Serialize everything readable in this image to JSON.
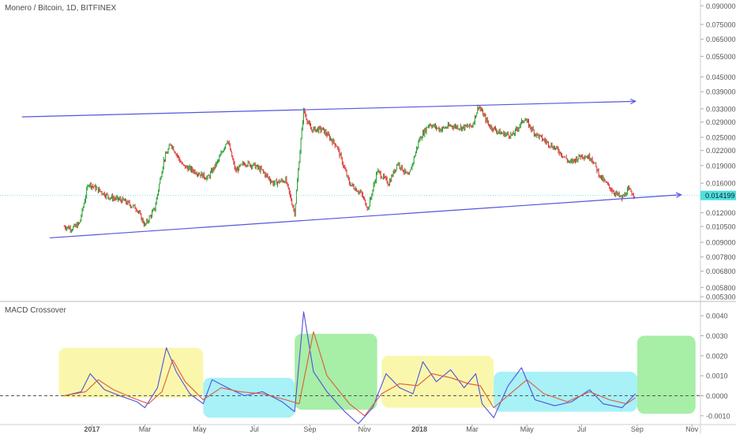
{
  "header": {
    "symbol_title": "Monero / Bitcoin, 1D, BITFINEX",
    "macd_title": "MACD Crossover"
  },
  "price_badge": "0.014199",
  "colors": {
    "up_candle": "#1f9d2a",
    "down_candle": "#e03030",
    "trendline": "#5555dd",
    "badge": "#4ee0e0",
    "macd_line": "#5050dd",
    "signal_line": "#e05a3a",
    "zero_line": "#555555",
    "yellow_box": "#f5f06a",
    "cyan_box": "#5ee6f0",
    "green_box": "#5fe05f"
  },
  "chart_data": [
    {
      "type": "candlestick",
      "title": "Monero / Bitcoin, 1D, BITFINEX",
      "y_scale": "log",
      "ylim": [
        0.0051,
        0.095
      ],
      "y_ticks": [
        "0.090000",
        "0.075000",
        "0.065000",
        "0.055000",
        "0.045000",
        "0.039000",
        "0.033000",
        "0.029000",
        "0.025000",
        "0.022000",
        "0.019000",
        "0.016000",
        "0.014199",
        "0.012000",
        "0.010500",
        "0.009000",
        "0.007800",
        "0.006800",
        "0.005800",
        "0.005300"
      ],
      "x_ticks": [
        "2017",
        "Mar",
        "May",
        "Jul",
        "Sep",
        "Nov",
        "2018",
        "Mar",
        "May",
        "Jul",
        "Sep",
        "Nov"
      ],
      "x_range": [
        "2016-10-01",
        "2018-11-30"
      ],
      "price_path": [
        [
          "2016-12-01",
          0.0105
        ],
        [
          "2016-12-10",
          0.0103
        ],
        [
          "2016-12-18",
          0.0108
        ],
        [
          "2016-12-28",
          0.016
        ],
        [
          "2017-01-08",
          0.015
        ],
        [
          "2017-01-20",
          0.014
        ],
        [
          "2017-02-05",
          0.0135
        ],
        [
          "2017-02-20",
          0.0125
        ],
        [
          "2017-03-01",
          0.0106
        ],
        [
          "2017-03-12",
          0.0125
        ],
        [
          "2017-03-22",
          0.02
        ],
        [
          "2017-03-30",
          0.0235
        ],
        [
          "2017-04-12",
          0.019
        ],
        [
          "2017-04-28",
          0.0178
        ],
        [
          "2017-05-10",
          0.0168
        ],
        [
          "2017-05-22",
          0.02
        ],
        [
          "2017-06-01",
          0.0245
        ],
        [
          "2017-06-10",
          0.018
        ],
        [
          "2017-06-20",
          0.0195
        ],
        [
          "2017-07-01",
          0.019
        ],
        [
          "2017-07-10",
          0.018
        ],
        [
          "2017-07-22",
          0.016
        ],
        [
          "2017-08-05",
          0.0165
        ],
        [
          "2017-08-15",
          0.012
        ],
        [
          "2017-08-20",
          0.02
        ],
        [
          "2017-08-25",
          0.0325
        ],
        [
          "2017-09-02",
          0.027
        ],
        [
          "2017-09-15",
          0.027
        ],
        [
          "2017-10-01",
          0.023
        ],
        [
          "2017-10-15",
          0.016
        ],
        [
          "2017-10-28",
          0.0145
        ],
        [
          "2017-11-05",
          0.0125
        ],
        [
          "2017-11-15",
          0.018
        ],
        [
          "2017-11-28",
          0.016
        ],
        [
          "2017-12-08",
          0.0195
        ],
        [
          "2017-12-20",
          0.017
        ],
        [
          "2018-01-01",
          0.0245
        ],
        [
          "2018-01-12",
          0.0285
        ],
        [
          "2018-01-24",
          0.027
        ],
        [
          "2018-02-05",
          0.028
        ],
        [
          "2018-02-18",
          0.0275
        ],
        [
          "2018-03-01",
          0.028
        ],
        [
          "2018-03-08",
          0.034
        ],
        [
          "2018-03-20",
          0.028
        ],
        [
          "2018-04-02",
          0.026
        ],
        [
          "2018-04-15",
          0.0255
        ],
        [
          "2018-04-28",
          0.03
        ],
        [
          "2018-05-10",
          0.026
        ],
        [
          "2018-05-22",
          0.024
        ],
        [
          "2018-06-05",
          0.022
        ],
        [
          "2018-06-18",
          0.0195
        ],
        [
          "2018-07-01",
          0.021
        ],
        [
          "2018-07-12",
          0.0205
        ],
        [
          "2018-07-22",
          0.017
        ],
        [
          "2018-08-05",
          0.0148
        ],
        [
          "2018-08-15",
          0.0138
        ],
        [
          "2018-08-22",
          0.015
        ],
        [
          "2018-08-30",
          0.0142
        ]
      ],
      "trendlines": [
        {
          "from": [
            "2016-10-15",
            0.0305
          ],
          "to": [
            "2018-08-30",
            0.0355
          ],
          "arrow": true
        },
        {
          "from": [
            "2016-11-15",
            0.0094
          ],
          "to": [
            "2018-10-20",
            0.0143
          ],
          "arrow": true
        }
      ]
    },
    {
      "type": "line",
      "title": "MACD Crossover",
      "ylim": [
        -0.0014,
        0.0044
      ],
      "y_ticks": [
        "0.0040",
        "0.0030",
        "0.0020",
        "0.0010",
        "0.0000",
        "-0.0010"
      ],
      "series": [
        {
          "points": [
            [
              "2016-12-01",
              0.0
            ],
            [
              "2016-12-20",
              0.0002
            ],
            [
              "2016-12-30",
              0.0011
            ],
            [
              "2017-01-15",
              0.0003
            ],
            [
              "2017-02-01",
              0.0
            ],
            [
              "2017-02-20",
              -0.0003
            ],
            [
              "2017-03-01",
              -0.0006
            ],
            [
              "2017-03-15",
              0.0004
            ],
            [
              "2017-03-25",
              0.0024
            ],
            [
              "2017-04-05",
              0.0012
            ],
            [
              "2017-04-20",
              0.0001
            ],
            [
              "2017-05-05",
              -0.0004
            ],
            [
              "2017-05-15",
              0.0008
            ],
            [
              "2017-06-01",
              0.0004
            ],
            [
              "2017-06-20",
              0.0
            ],
            [
              "2017-07-10",
              0.0002
            ],
            [
              "2017-08-01",
              -0.0003
            ],
            [
              "2017-08-15",
              -0.0008
            ],
            [
              "2017-08-25",
              0.0042
            ],
            [
              "2017-09-05",
              0.0012
            ],
            [
              "2017-09-20",
              0.0002
            ],
            [
              "2017-10-10",
              -0.0008
            ],
            [
              "2017-10-25",
              -0.0014
            ],
            [
              "2017-11-10",
              -0.0006
            ],
            [
              "2017-11-25",
              0.0011
            ],
            [
              "2017-12-10",
              0.0004
            ],
            [
              "2017-12-25",
              0.0001
            ],
            [
              "2018-01-05",
              0.0017
            ],
            [
              "2018-01-20",
              0.0007
            ],
            [
              "2018-02-05",
              0.0013
            ],
            [
              "2018-02-20",
              0.0004
            ],
            [
              "2018-03-05",
              0.0011
            ],
            [
              "2018-03-12",
              -0.0004
            ],
            [
              "2018-03-25",
              -0.0011
            ],
            [
              "2018-04-10",
              0.0005
            ],
            [
              "2018-04-25",
              0.0014
            ],
            [
              "2018-05-10",
              -0.0002
            ],
            [
              "2018-06-01",
              -0.0005
            ],
            [
              "2018-06-20",
              -0.0003
            ],
            [
              "2018-07-10",
              0.0003
            ],
            [
              "2018-07-25",
              -0.0004
            ],
            [
              "2018-08-15",
              -0.0006
            ],
            [
              "2018-08-30",
              0.0001
            ]
          ]
        },
        {
          "points": [
            [
              "2016-12-01",
              0.0
            ],
            [
              "2016-12-25",
              0.0002
            ],
            [
              "2017-01-08",
              0.0008
            ],
            [
              "2017-01-25",
              0.0003
            ],
            [
              "2017-02-15",
              -0.0001
            ],
            [
              "2017-03-05",
              -0.0004
            ],
            [
              "2017-03-20",
              0.0002
            ],
            [
              "2017-04-01",
              0.0018
            ],
            [
              "2017-04-15",
              0.0007
            ],
            [
              "2017-05-05",
              -0.0002
            ],
            [
              "2017-05-25",
              0.0004
            ],
            [
              "2017-06-15",
              0.0002
            ],
            [
              "2017-07-10",
              0.0001
            ],
            [
              "2017-08-05",
              -0.0002
            ],
            [
              "2017-08-20",
              -0.0004
            ],
            [
              "2017-09-05",
              0.0032
            ],
            [
              "2017-09-20",
              0.001
            ],
            [
              "2017-10-15",
              -0.0004
            ],
            [
              "2017-11-01",
              -0.001
            ],
            [
              "2017-11-20",
              0.0001
            ],
            [
              "2017-12-10",
              0.0006
            ],
            [
              "2017-12-30",
              0.0005
            ],
            [
              "2018-01-15",
              0.0011
            ],
            [
              "2018-02-05",
              0.0009
            ],
            [
              "2018-02-25",
              0.0006
            ],
            [
              "2018-03-10",
              0.0005
            ],
            [
              "2018-03-25",
              -0.0006
            ],
            [
              "2018-04-15",
              0.0002
            ],
            [
              "2018-05-01",
              0.0008
            ],
            [
              "2018-05-20",
              0.0001
            ],
            [
              "2018-06-15",
              -0.0003
            ],
            [
              "2018-07-10",
              0.0002
            ],
            [
              "2018-08-01",
              -0.0002
            ],
            [
              "2018-08-20",
              -0.0004
            ],
            [
              "2018-08-30",
              -0.0001
            ]
          ]
        }
      ],
      "zero_line": "dashed"
    }
  ],
  "highlight_boxes": [
    {
      "color": "yellow",
      "x": [
        "2016-11-25",
        "2017-05-05"
      ],
      "y": [
        -0.0001,
        0.0024
      ]
    },
    {
      "color": "cyan",
      "x": [
        "2017-05-05",
        "2017-08-15"
      ],
      "y": [
        -0.0011,
        0.0009
      ]
    },
    {
      "color": "green",
      "x": [
        "2017-08-15",
        "2017-11-15"
      ],
      "y": [
        -0.0007,
        0.0031
      ]
    },
    {
      "color": "yellow",
      "x": [
        "2017-11-20",
        "2018-03-25"
      ],
      "y": [
        -0.0006,
        0.002
      ]
    },
    {
      "color": "cyan",
      "x": [
        "2018-03-25",
        "2018-09-01"
      ],
      "y": [
        -0.0008,
        0.0012
      ]
    },
    {
      "color": "green",
      "x": [
        "2018-09-01",
        "2018-11-05"
      ],
      "y": [
        -0.0009,
        0.003
      ]
    }
  ]
}
